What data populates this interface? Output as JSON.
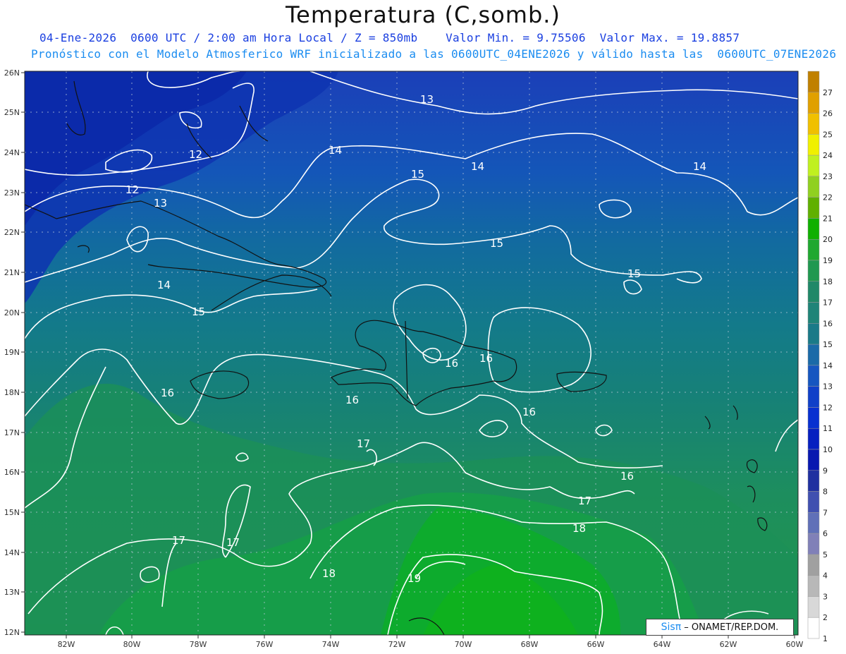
{
  "title": "Temperatura (C,somb.)",
  "subtitle_line1": "04-Ene-2026  0600 UTC / 2:00 am Hora Local / Z = 850mb    Valor Min. = 9.75506  Valor Max. = 19.8857",
  "subtitle_line2": "Pronóstico con el Modelo Atmosferico WRF inicializado a las 0600UTC_04ENE2026 y válido hasta las  0600UTC_07ENE2026",
  "credit": {
    "logo": "Sisπ",
    "text": "– ONAMET/REP.DOM."
  },
  "map": {
    "lat_labels": [
      "26N",
      "25N",
      "24N",
      "23N",
      "22N",
      "21N",
      "20N",
      "19N",
      "18N",
      "17N",
      "16N",
      "15N",
      "14N",
      "13N",
      "12N"
    ],
    "lon_labels": [
      "82W",
      "80W",
      "78W",
      "76W",
      "74W",
      "72W",
      "70W",
      "68W",
      "66W",
      "64W",
      "62W",
      "60W"
    ],
    "contour_labels": [
      "13",
      "12",
      "12",
      "13",
      "14",
      "14",
      "14",
      "14",
      "15",
      "15",
      "15",
      "15",
      "16",
      "16",
      "16",
      "16",
      "16",
      "17",
      "17",
      "17",
      "17",
      "18",
      "18",
      "19"
    ]
  },
  "colorbar": {
    "labels": [
      "27",
      "26",
      "25",
      "24",
      "23",
      "22",
      "21",
      "20",
      "19",
      "18",
      "17",
      "16",
      "15",
      "14",
      "13",
      "12",
      "11",
      "10",
      "9",
      "8",
      "7",
      "6",
      "5",
      "4",
      "3",
      "2",
      "1"
    ],
    "colors": [
      "#c08000",
      "#e0a000",
      "#f0c000",
      "#f0f000",
      "#c0f020",
      "#90d020",
      "#60b000",
      "#10b000",
      "#20a830",
      "#209850",
      "#208868",
      "#1f8478",
      "#1a7a88",
      "#1a6aa8",
      "#1656c0",
      "#1040c8",
      "#0830d0",
      "#0620c0",
      "#0818b0",
      "#2030a0",
      "#4050b0",
      "#6070b8",
      "#8080b8",
      "#a0a0a0",
      "#b8b8b8",
      "#d8d8d8",
      "#ffffff"
    ]
  }
}
